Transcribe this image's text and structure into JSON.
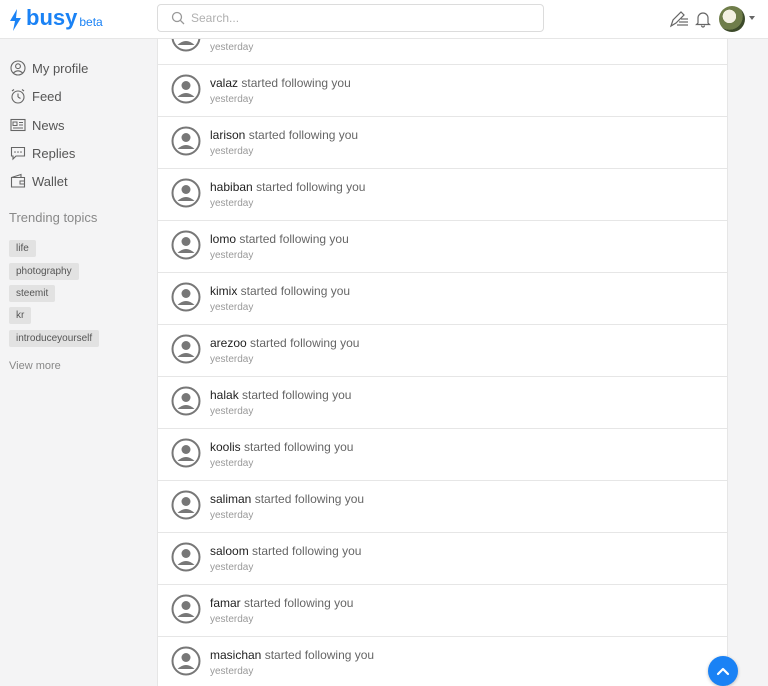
{
  "header": {
    "logo_text": "busy",
    "logo_beta": "beta",
    "search_placeholder": "Search...",
    "brand_color": "#1a82f5"
  },
  "sidebar": {
    "nav": [
      {
        "label": "My profile",
        "icon": "user-circle-icon"
      },
      {
        "label": "Feed",
        "icon": "clock-icon"
      },
      {
        "label": "News",
        "icon": "newspaper-icon"
      },
      {
        "label": "Replies",
        "icon": "chat-icon"
      },
      {
        "label": "Wallet",
        "icon": "wallet-icon"
      }
    ],
    "trending_title": "Trending topics",
    "tags": [
      "life",
      "photography",
      "steemit",
      "kr",
      "introduceyourself"
    ],
    "view_more": "View more"
  },
  "notifications": {
    "action_text": "started following you",
    "items": [
      {
        "user": "",
        "time": "yesterday"
      },
      {
        "user": "valaz",
        "time": "yesterday"
      },
      {
        "user": "larison",
        "time": "yesterday"
      },
      {
        "user": "habiban",
        "time": "yesterday"
      },
      {
        "user": "lomo",
        "time": "yesterday"
      },
      {
        "user": "kimix",
        "time": "yesterday"
      },
      {
        "user": "arezoo",
        "time": "yesterday"
      },
      {
        "user": "halak",
        "time": "yesterday"
      },
      {
        "user": "koolis",
        "time": "yesterday"
      },
      {
        "user": "saliman",
        "time": "yesterday"
      },
      {
        "user": "saloom",
        "time": "yesterday"
      },
      {
        "user": "famar",
        "time": "yesterday"
      },
      {
        "user": "masichan",
        "time": "yesterday"
      }
    ]
  }
}
